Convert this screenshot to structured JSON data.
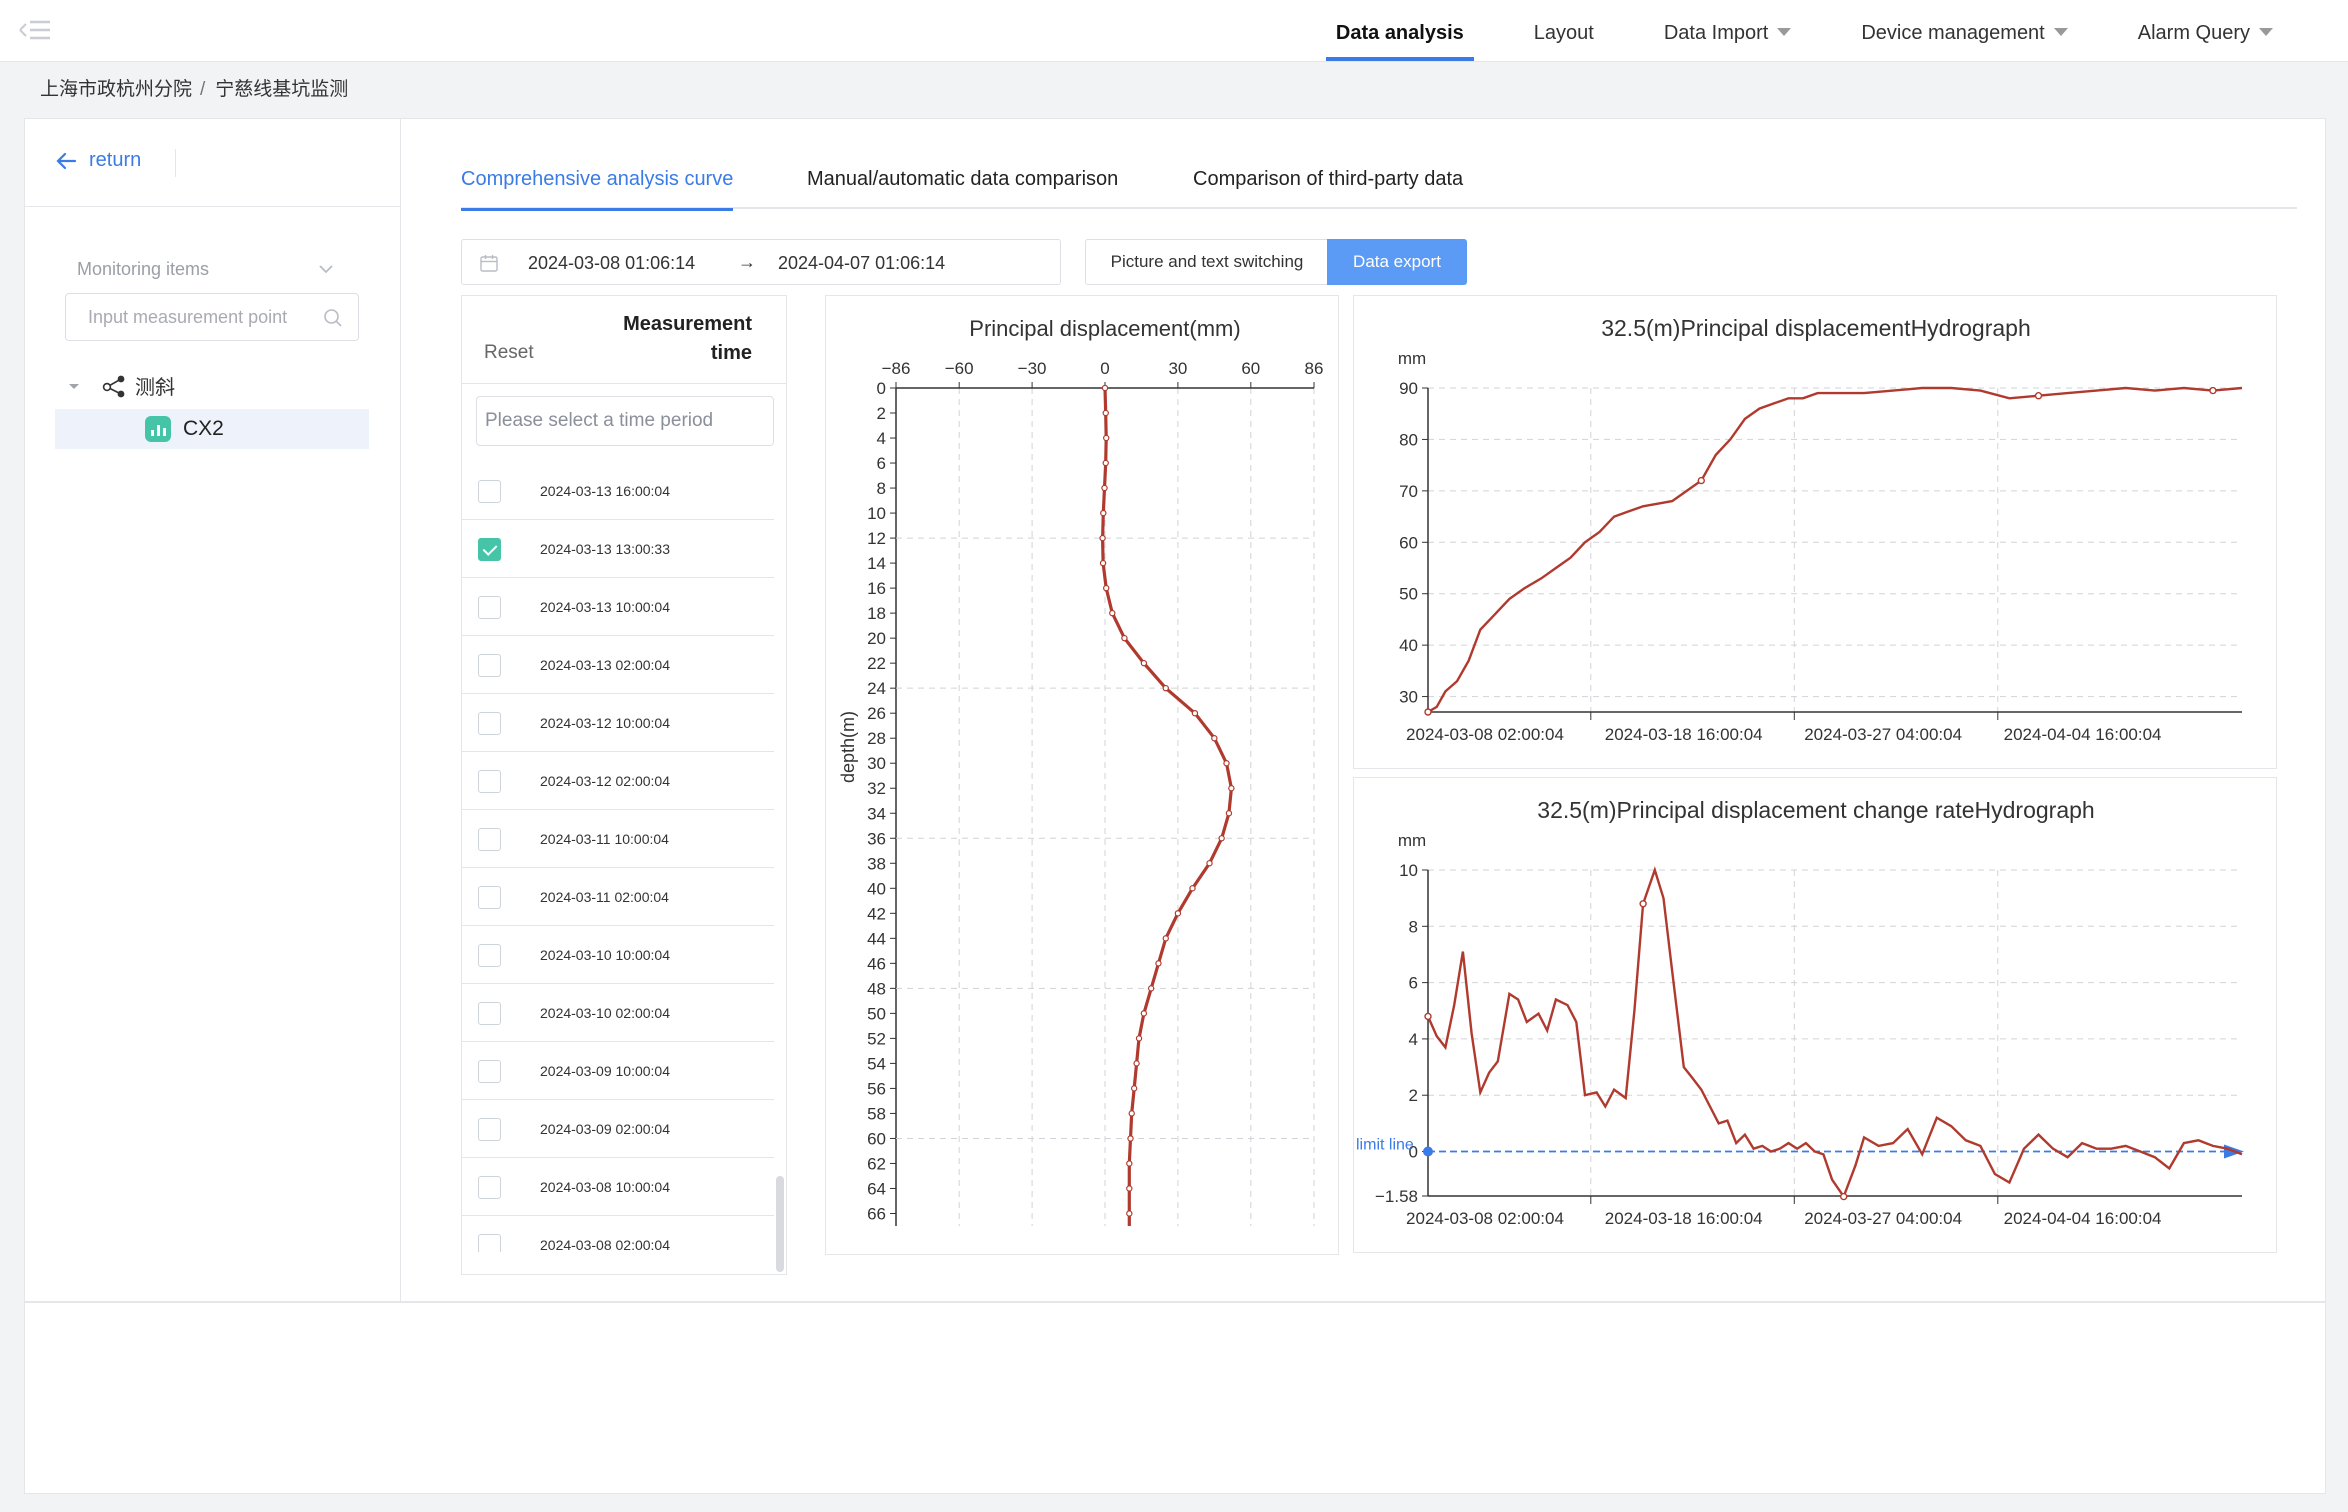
{
  "nav": {
    "items": [
      {
        "label": "Data analysis",
        "active": true,
        "dropdown": false
      },
      {
        "label": "Layout",
        "active": false,
        "dropdown": false
      },
      {
        "label": "Data Import",
        "active": false,
        "dropdown": true
      },
      {
        "label": "Device management",
        "active": false,
        "dropdown": true
      },
      {
        "label": "Alarm Query",
        "active": false,
        "dropdown": true
      }
    ]
  },
  "breadcrumb": {
    "org": "上海市政杭州分院",
    "separator": "/",
    "project": "宁慈线基坑监测"
  },
  "sidebar": {
    "return_label": "return",
    "monitoring_placeholder": "Monitoring items",
    "search_placeholder": "Input measurement point",
    "tree": {
      "root": "测斜",
      "child": "CX2"
    }
  },
  "tabs": [
    {
      "label": "Comprehensive analysis curve",
      "active": true
    },
    {
      "label": "Manual/automatic data comparison",
      "active": false
    },
    {
      "label": "Comparison of third-party data",
      "active": false
    }
  ],
  "toolbar": {
    "start_date": "2024-03-08 01:06:14",
    "end_date": "2024-04-07 01:06:14",
    "switch_label": "Picture and text switching",
    "export_label": "Data export"
  },
  "measurement": {
    "reset_label": "Reset",
    "title_line1": "Measurement",
    "title_line2": "time",
    "filter_placeholder": "Please select a time period",
    "rows": [
      {
        "time": "2024-03-13 16:00:04",
        "checked": false
      },
      {
        "time": "2024-03-13 13:00:33",
        "checked": true
      },
      {
        "time": "2024-03-13 10:00:04",
        "checked": false
      },
      {
        "time": "2024-03-13 02:00:04",
        "checked": false
      },
      {
        "time": "2024-03-12 10:00:04",
        "checked": false
      },
      {
        "time": "2024-03-12 02:00:04",
        "checked": false
      },
      {
        "time": "2024-03-11 10:00:04",
        "checked": false
      },
      {
        "time": "2024-03-11 02:00:04",
        "checked": false
      },
      {
        "time": "2024-03-10 10:00:04",
        "checked": false
      },
      {
        "time": "2024-03-10 02:00:04",
        "checked": false
      },
      {
        "time": "2024-03-09 10:00:04",
        "checked": false
      },
      {
        "time": "2024-03-09 02:00:04",
        "checked": false
      },
      {
        "time": "2024-03-08 10:00:04",
        "checked": false
      },
      {
        "time": "2024-03-08 02:00:04",
        "checked": false
      }
    ]
  },
  "chart_data": [
    {
      "type": "line",
      "title": "Principal displacement(mm)",
      "xlabel": "",
      "ylabel": "depth(m)",
      "xlim": [
        -86,
        86
      ],
      "xticks": [
        "-86",
        "-60",
        "-30",
        "0",
        "30",
        "60",
        "86"
      ],
      "ylim": [
        0,
        67
      ],
      "yticks": [
        "0",
        "2",
        "4",
        "6",
        "8",
        "10",
        "12",
        "14",
        "16",
        "18",
        "20",
        "22",
        "24",
        "26",
        "28",
        "30",
        "32",
        "34",
        "36",
        "38",
        "40",
        "42",
        "44",
        "46",
        "48",
        "50",
        "52",
        "54",
        "56",
        "58",
        "60",
        "62",
        "64",
        "66"
      ],
      "y_inverted": true,
      "grid": true,
      "color": "#b03a2e",
      "series": [
        {
          "depth": [
            0,
            2,
            4,
            6,
            8,
            10,
            12,
            14,
            16,
            18,
            20,
            22,
            24,
            26,
            28,
            30,
            32,
            34,
            36,
            38,
            40,
            42,
            44,
            46,
            48,
            50,
            52,
            54,
            56,
            58,
            60,
            62,
            64,
            66,
            67
          ],
          "values": [
            0,
            0.3,
            0.5,
            0.3,
            -0.2,
            -0.7,
            -1,
            -0.8,
            0.5,
            3,
            8,
            16,
            25,
            37,
            45,
            50,
            52,
            51,
            48,
            43,
            36,
            30,
            25,
            22,
            19,
            16,
            14,
            13,
            12,
            11,
            10.5,
            10,
            10,
            10,
            10
          ]
        }
      ]
    },
    {
      "type": "line",
      "title": "32.5(m)Principal displacementHydrograph",
      "unit": "mm",
      "ylim": [
        27,
        90
      ],
      "yticks": [
        "30",
        "40",
        "50",
        "60",
        "70",
        "80",
        "90"
      ],
      "xticks": [
        "2024-03-08 02:00:04",
        "2024-03-18 16:00:04",
        "2024-03-27 04:00:04",
        "2024-04-04 16:00:04"
      ],
      "xlim_days": [
        0,
        28
      ],
      "grid": true,
      "color": "#b03a2e",
      "series": [
        {
          "x_days": [
            0,
            0.3,
            0.6,
            1,
            1.4,
            1.8,
            2.3,
            2.8,
            3.3,
            3.9,
            4.4,
            4.9,
            5.4,
            5.9,
            6.4,
            6.9,
            7.4,
            7.9,
            8.4,
            8.9,
            9.4,
            9.9,
            10.4,
            10.9,
            11.4,
            11.9,
            12.4,
            12.9,
            13.4,
            13.9,
            14.4,
            15,
            16,
            17,
            18,
            19,
            20,
            21,
            22,
            23,
            24,
            25,
            26,
            27,
            28
          ],
          "values": [
            27,
            28,
            31,
            33,
            37,
            43,
            46,
            49,
            51,
            53,
            55,
            57,
            60,
            62,
            65,
            66,
            67,
            67.5,
            68,
            70,
            72,
            77,
            80,
            84,
            86,
            87,
            88,
            88,
            89,
            89,
            89,
            89,
            89.5,
            90,
            90,
            89.5,
            88,
            88.5,
            89,
            89.5,
            90,
            89.5,
            90,
            89.5,
            90
          ]
        }
      ]
    },
    {
      "type": "line",
      "title": "32.5(m)Principal displacement change rateHydrograph",
      "unit": "mm",
      "ylim": [
        -1.58,
        10
      ],
      "yticks": [
        "10",
        "8",
        "6",
        "4",
        "2",
        "0",
        "-1.58"
      ],
      "xticks": [
        "2024-03-08 02:00:04",
        "2024-03-18 16:00:04",
        "2024-03-27 04:00:04",
        "2024-04-04 16:00:04"
      ],
      "xlim_days": [
        0,
        28
      ],
      "grid": true,
      "color": "#b03a2e",
      "limit_line": {
        "label": "limit line",
        "value": 0,
        "color": "#3a7be6"
      },
      "series": [
        {
          "x_days": [
            0,
            0.3,
            0.6,
            0.9,
            1.2,
            1.5,
            1.8,
            2.1,
            2.4,
            2.8,
            3.1,
            3.4,
            3.8,
            4.1,
            4.4,
            4.8,
            5.1,
            5.4,
            5.8,
            6.1,
            6.4,
            6.8,
            7.1,
            7.4,
            7.8,
            8.1,
            8.4,
            8.8,
            9.1,
            9.4,
            9.7,
            10,
            10.3,
            10.6,
            10.9,
            11.2,
            11.5,
            11.8,
            12.1,
            12.4,
            12.7,
            13,
            13.3,
            13.6,
            13.9,
            14.3,
            14.7,
            15,
            15.5,
            16,
            16.5,
            17,
            17.5,
            18,
            18.5,
            19,
            19.5,
            20,
            20.5,
            21,
            21.5,
            22,
            22.5,
            23,
            23.5,
            24,
            24.5,
            25,
            25.5,
            26,
            26.5,
            27,
            27.5,
            28
          ],
          "values": [
            4.8,
            4.1,
            3.7,
            5.2,
            7.1,
            4.2,
            2.1,
            2.8,
            3.2,
            5.6,
            5.4,
            4.6,
            4.9,
            4.3,
            5.4,
            5.2,
            4.6,
            2.0,
            2.1,
            1.6,
            2.2,
            1.9,
            5.0,
            8.8,
            10.0,
            9.0,
            6.4,
            3.0,
            2.6,
            2.2,
            1.6,
            1.0,
            1.1,
            0.3,
            0.6,
            0.1,
            0.2,
            0.0,
            0.1,
            0.3,
            0.1,
            0.3,
            0.0,
            -0.1,
            -1.0,
            -1.6,
            -0.5,
            0.5,
            0.2,
            0.3,
            0.8,
            -0.1,
            1.2,
            0.9,
            0.4,
            0.2,
            -0.8,
            -1.1,
            0.1,
            0.6,
            0.1,
            -0.2,
            0.3,
            0.1,
            0.1,
            0.2,
            0.0,
            -0.2,
            -0.6,
            0.3,
            0.4,
            0.2,
            0.1,
            -0.1
          ]
        }
      ]
    }
  ]
}
